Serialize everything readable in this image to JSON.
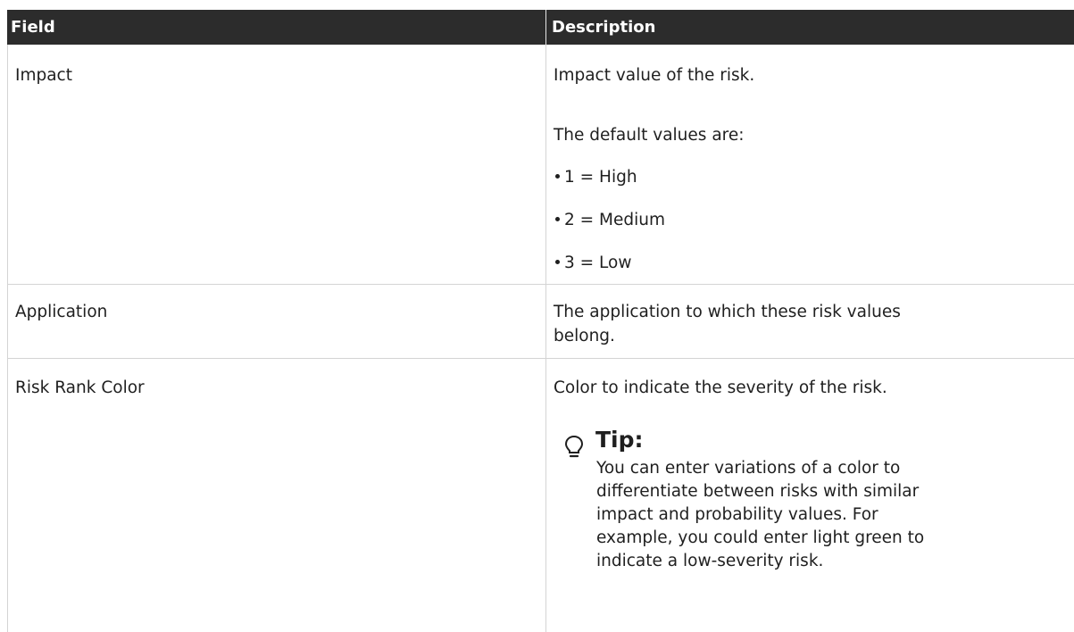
{
  "table": {
    "headers": {
      "field": "Field",
      "description": "Description"
    },
    "rows": [
      {
        "field": "Impact",
        "description": {
          "intro": "Impact value of the risk.",
          "lead": "The default values are:",
          "bullets": [
            "1 = High",
            "2 = Medium",
            "3 = Low"
          ]
        }
      },
      {
        "field": "Application",
        "description": {
          "line1": "The application to which these risk values",
          "line2": "belong."
        }
      },
      {
        "field": "Risk Rank Color",
        "description": {
          "intro": "Color to indicate the severity of the risk.",
          "tip": {
            "title": "Tip:",
            "icon": "lightbulb-icon",
            "body": "You can enter variations of a color to\ndifferentiate between risks with similar\nimpact and probability values. For\nexample, you could enter light green to\nindicate a low-severity risk."
          }
        }
      }
    ]
  },
  "colors": {
    "header_background": "#2c2c2c",
    "header_text": "#ffffff",
    "grid_line": "#d4d4d4",
    "body_text": "#1f1f1f"
  }
}
